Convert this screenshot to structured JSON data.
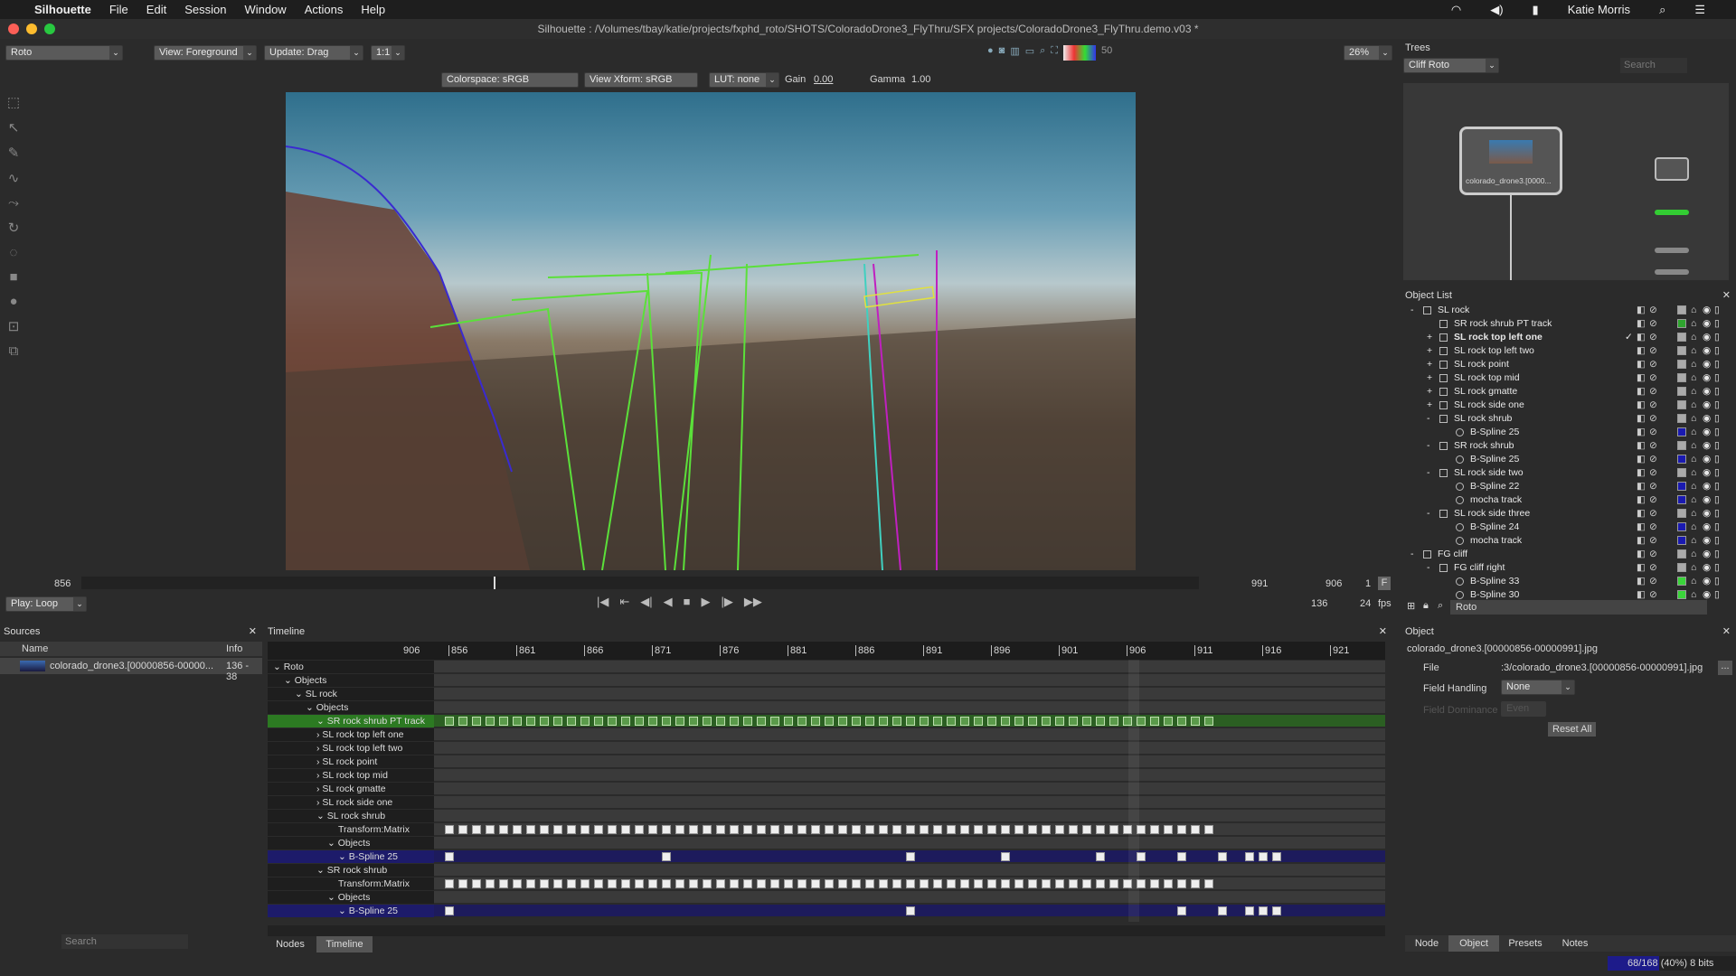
{
  "menubar": {
    "apple": "",
    "app": "Silhouette",
    "items": [
      "File",
      "Edit",
      "Session",
      "Window",
      "Actions",
      "Help"
    ],
    "user": "Katie Morris"
  },
  "window": {
    "title": "Silhouette : /Volumes/tbay/katie/projects/fxphd_roto/SHOTS/ColoradoDrone3_FlyThru/SFX projects/ColoradoDrone3_FlyThru.demo.v03 *"
  },
  "toolbar": {
    "mode": "Roto",
    "view": "View: Foreground",
    "update": "Update: Drag",
    "ratio": "1:1",
    "zoom": "26%",
    "quality": "50",
    "colorspace": "Colorspace: sRGB",
    "view_xform": "View Xform: sRGB",
    "lut": "LUT: none",
    "gain_label": "Gain",
    "gain": "0.00",
    "gamma_label": "Gamma",
    "gamma": "1.00"
  },
  "trees": {
    "title": "Trees",
    "selected": "Cliff Roto",
    "search_placeholder": "Search",
    "node_label": "colorado_drone3.[0000..."
  },
  "transport": {
    "start": "856",
    "end": "991",
    "current": "906",
    "step": "1",
    "f_button": "F",
    "duration": "136",
    "fps": "24",
    "fps_label": "fps",
    "play_mode": "Play: Loop"
  },
  "sources": {
    "title": "Sources",
    "col_name": "Name",
    "col_info": "Info",
    "rows": [
      {
        "name": "colorado_drone3.[00000856-00000...",
        "info": "136 - 38"
      }
    ],
    "search_placeholder": "Search"
  },
  "timeline": {
    "title": "Timeline",
    "current": "906",
    "ticks": [
      "856",
      "861",
      "866",
      "871",
      "876",
      "881",
      "886",
      "891",
      "896",
      "901",
      "906",
      "911",
      "916",
      "921"
    ],
    "rows": [
      {
        "label": "Roto",
        "indent": 0,
        "arrow": "v",
        "type": "plain"
      },
      {
        "label": "Objects",
        "indent": 1,
        "arrow": "v",
        "type": "plain"
      },
      {
        "label": "SL rock",
        "indent": 2,
        "arrow": "v",
        "type": "plain"
      },
      {
        "label": "Objects",
        "indent": 3,
        "arrow": "v",
        "type": "plain"
      },
      {
        "label": "SR rock shrub PT track",
        "indent": 4,
        "arrow": "v",
        "type": "green",
        "keys": "all"
      },
      {
        "label": "SL rock top left one",
        "indent": 4,
        "arrow": ">",
        "type": "plain"
      },
      {
        "label": "SL rock top left two",
        "indent": 4,
        "arrow": ">",
        "type": "plain"
      },
      {
        "label": "SL rock point",
        "indent": 4,
        "arrow": ">",
        "type": "plain"
      },
      {
        "label": "SL rock top mid",
        "indent": 4,
        "arrow": ">",
        "type": "plain"
      },
      {
        "label": "SL rock gmatte",
        "indent": 4,
        "arrow": ">",
        "type": "plain"
      },
      {
        "label": "SL rock side one",
        "indent": 4,
        "arrow": ">",
        "type": "plain"
      },
      {
        "label": "SL rock shrub",
        "indent": 4,
        "arrow": "v",
        "type": "plain"
      },
      {
        "label": "Transform:Matrix",
        "indent": 6,
        "arrow": "",
        "type": "plain",
        "keys": "all"
      },
      {
        "label": "Objects",
        "indent": 5,
        "arrow": "v",
        "type": "plain"
      },
      {
        "label": "B-Spline 25",
        "indent": 6,
        "arrow": "v",
        "type": "blue",
        "keys": [
          856,
          872,
          890,
          897,
          904,
          907,
          910,
          913,
          915,
          916,
          917
        ]
      },
      {
        "label": "SR rock shrub",
        "indent": 4,
        "arrow": "v",
        "type": "plain"
      },
      {
        "label": "Transform:Matrix",
        "indent": 6,
        "arrow": "",
        "type": "plain",
        "keys": "all"
      },
      {
        "label": "Objects",
        "indent": 5,
        "arrow": "v",
        "type": "plain"
      },
      {
        "label": "B-Spline 25",
        "indent": 6,
        "arrow": "v",
        "type": "blue",
        "keys": [
          856,
          890,
          910,
          913,
          915,
          916,
          917
        ]
      }
    ]
  },
  "object_list": {
    "title": "Object List",
    "filter": "Roto",
    "rows": [
      {
        "label": "SL rock",
        "level": 0,
        "exp": "-",
        "color": "#aaaaaa"
      },
      {
        "label": "SR rock shrub PT track",
        "level": 1,
        "exp": "",
        "color": "#2fa52f"
      },
      {
        "label": "SL rock top left one",
        "level": 1,
        "exp": "+",
        "color": "#aaaaaa",
        "bold": true,
        "check": "✓"
      },
      {
        "label": "SL rock top left two",
        "level": 1,
        "exp": "+",
        "color": "#aaaaaa"
      },
      {
        "label": "SL rock point",
        "level": 1,
        "exp": "+",
        "color": "#aaaaaa"
      },
      {
        "label": "SL rock top mid",
        "level": 1,
        "exp": "+",
        "color": "#aaaaaa"
      },
      {
        "label": "SL rock gmatte",
        "level": 1,
        "exp": "+",
        "color": "#aaaaaa"
      },
      {
        "label": "SL rock side one",
        "level": 1,
        "exp": "+",
        "color": "#aaaaaa"
      },
      {
        "label": "SL rock shrub",
        "level": 1,
        "exp": "-",
        "color": "#aaaaaa"
      },
      {
        "label": "B-Spline 25",
        "level": 2,
        "exp": "",
        "color": "#1a1ab0"
      },
      {
        "label": "SR rock shrub",
        "level": 1,
        "exp": "-",
        "color": "#aaaaaa"
      },
      {
        "label": "B-Spline 25",
        "level": 2,
        "exp": "",
        "color": "#1a1ab0"
      },
      {
        "label": "SL rock side two",
        "level": 1,
        "exp": "-",
        "color": "#aaaaaa"
      },
      {
        "label": "B-Spline 22",
        "level": 2,
        "exp": "",
        "color": "#1a1ab0"
      },
      {
        "label": "mocha track",
        "level": 2,
        "exp": "",
        "color": "#1a1ab0"
      },
      {
        "label": "SL rock side three",
        "level": 1,
        "exp": "-",
        "color": "#aaaaaa"
      },
      {
        "label": "B-Spline 24",
        "level": 2,
        "exp": "",
        "color": "#1a1ab0"
      },
      {
        "label": "mocha track",
        "level": 2,
        "exp": "",
        "color": "#1a1ab0"
      },
      {
        "label": "FG cliff",
        "level": 0,
        "exp": "-",
        "color": "#aaaaaa"
      },
      {
        "label": "FG cliff right",
        "level": 1,
        "exp": "-",
        "color": "#aaaaaa"
      },
      {
        "label": "B-Spline 33",
        "level": 2,
        "exp": "",
        "color": "#3ad43a"
      },
      {
        "label": "B-Spline 30",
        "level": 2,
        "exp": "",
        "color": "#3ad43a"
      }
    ]
  },
  "object_panel": {
    "title": "Object",
    "name": "colorado_drone3.[00000856-00000991].jpg",
    "file_label": "File",
    "file": ":3/colorado_drone3.[00000856-00000991].jpg",
    "browse": "...",
    "field_handling_label": "Field Handling",
    "field_handling": "None",
    "field_dominance_label": "Field Dominance",
    "field_dominance": "Even",
    "reset": "Reset All",
    "tabs": [
      "Node",
      "Object",
      "Presets",
      "Notes"
    ]
  },
  "bottom_tabs": [
    "Nodes",
    "Timeline"
  ],
  "status": {
    "cache": "68/168 (40%) 8 bits",
    "cache_fraction": 0.4
  }
}
